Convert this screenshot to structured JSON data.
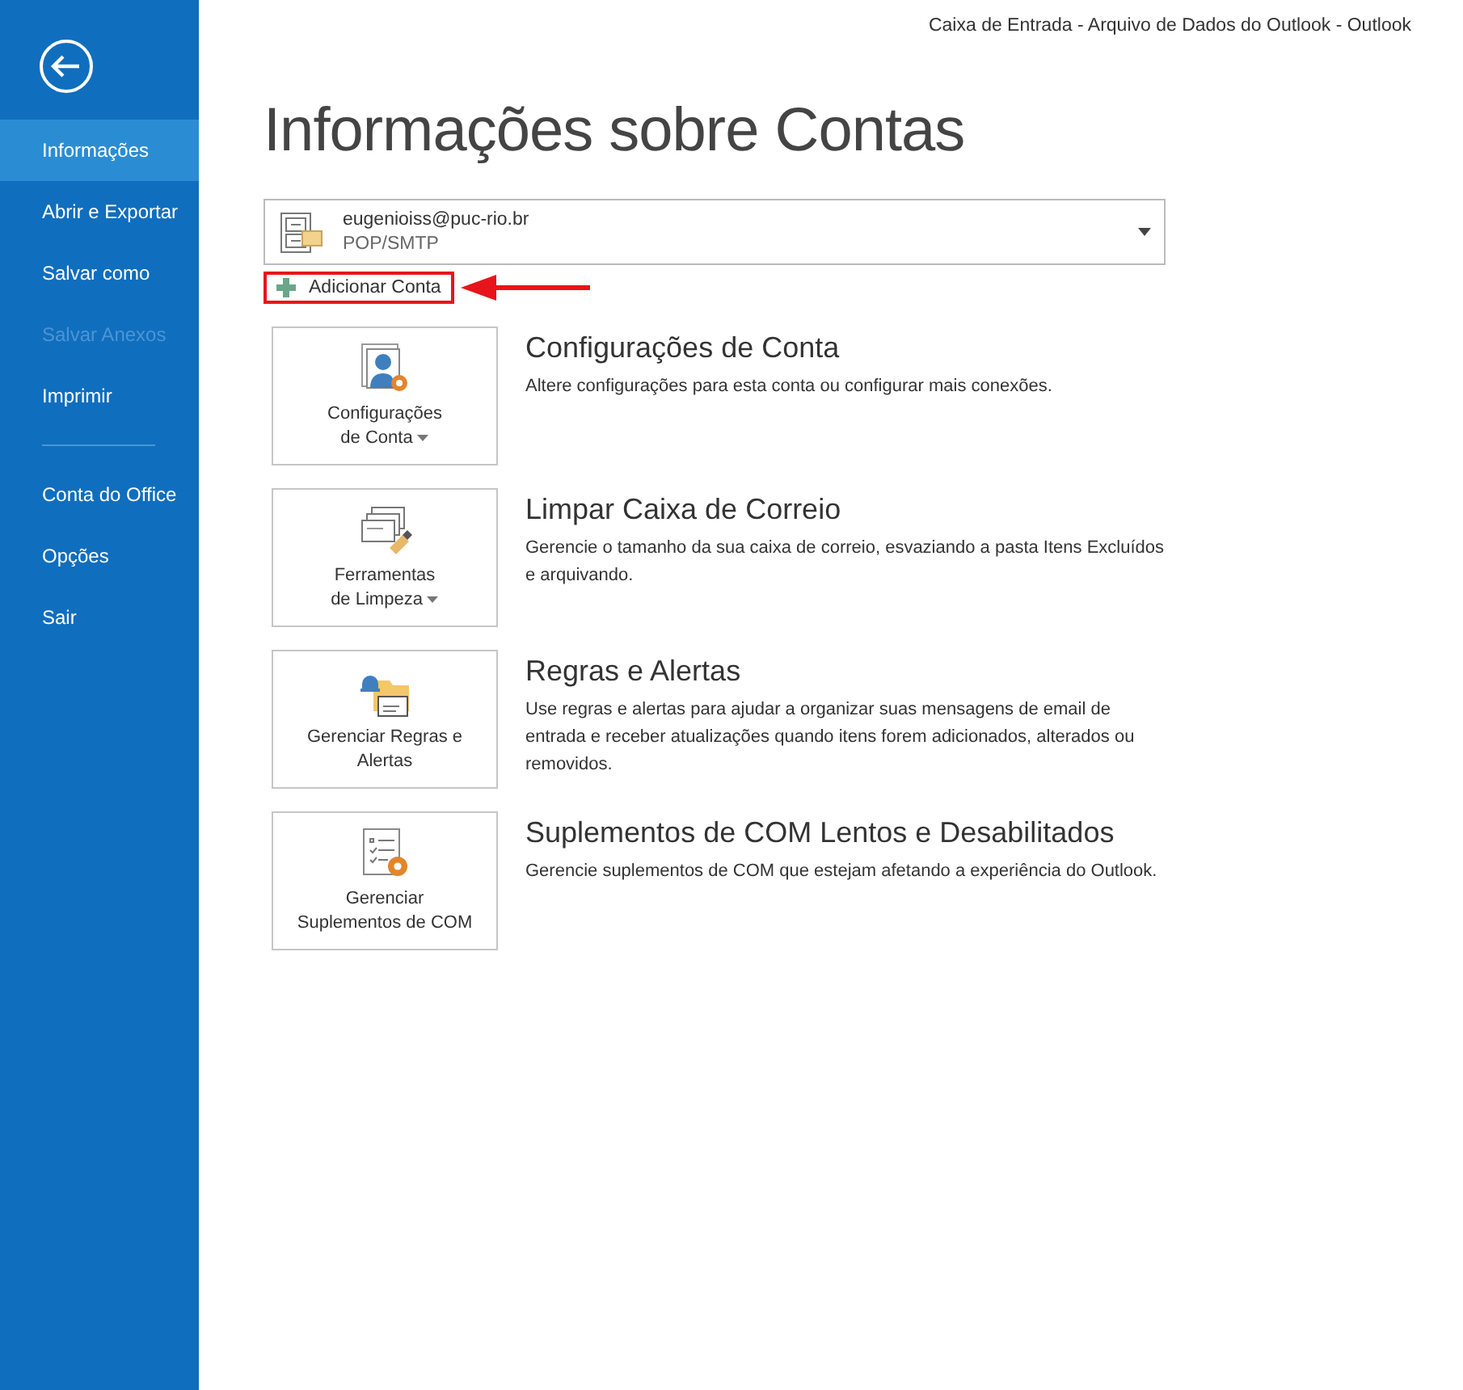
{
  "window": {
    "title": "Caixa de Entrada - Arquivo de Dados do Outlook - Outlook"
  },
  "sidebar": {
    "items": [
      {
        "label": "Informações",
        "selected": true,
        "disabled": false,
        "separator_after": false
      },
      {
        "label": "Abrir e Exportar",
        "selected": false,
        "disabled": false,
        "separator_after": false
      },
      {
        "label": "Salvar como",
        "selected": false,
        "disabled": false,
        "separator_after": false
      },
      {
        "label": "Salvar Anexos",
        "selected": false,
        "disabled": true,
        "separator_after": false
      },
      {
        "label": "Imprimir",
        "selected": false,
        "disabled": false,
        "separator_after": true
      },
      {
        "label": "Conta do Office",
        "selected": false,
        "disabled": false,
        "separator_after": false
      },
      {
        "label": "Opções",
        "selected": false,
        "disabled": false,
        "separator_after": false
      },
      {
        "label": "Sair",
        "selected": false,
        "disabled": false,
        "separator_after": false
      }
    ]
  },
  "heading": "Informações sobre Contas",
  "account": {
    "email": "eugenioiss@puc-rio.br",
    "type": "POP/SMTP"
  },
  "add_account": {
    "label": "Adicionar Conta",
    "highlighted": true
  },
  "sections": [
    {
      "kind": "settings",
      "button_lines": [
        "Configurações",
        "de Conta"
      ],
      "dropdown": true,
      "title": "Configurações de Conta",
      "description": "Altere configurações para esta conta ou configurar mais conexões."
    },
    {
      "kind": "cleanup",
      "button_lines": [
        "Ferramentas",
        "de Limpeza"
      ],
      "dropdown": true,
      "title": "Limpar Caixa de Correio",
      "description": "Gerencie o tamanho da sua caixa de correio, esvaziando a pasta Itens Excluídos e arquivando."
    },
    {
      "kind": "rules",
      "button_lines": [
        "Gerenciar Regras e",
        "Alertas"
      ],
      "dropdown": false,
      "title": "Regras e Alertas",
      "description": "Use regras e alertas para ajudar a organizar suas mensagens de email de entrada e receber atualizações quando itens forem adicionados, alterados ou removidos."
    },
    {
      "kind": "addins",
      "button_lines": [
        "Gerenciar",
        "Suplementos de COM"
      ],
      "dropdown": false,
      "title": "Suplementos de COM Lentos e Desabilitados",
      "description": "Gerencie suplementos de COM que estejam afetando a experiência do Outlook."
    }
  ]
}
